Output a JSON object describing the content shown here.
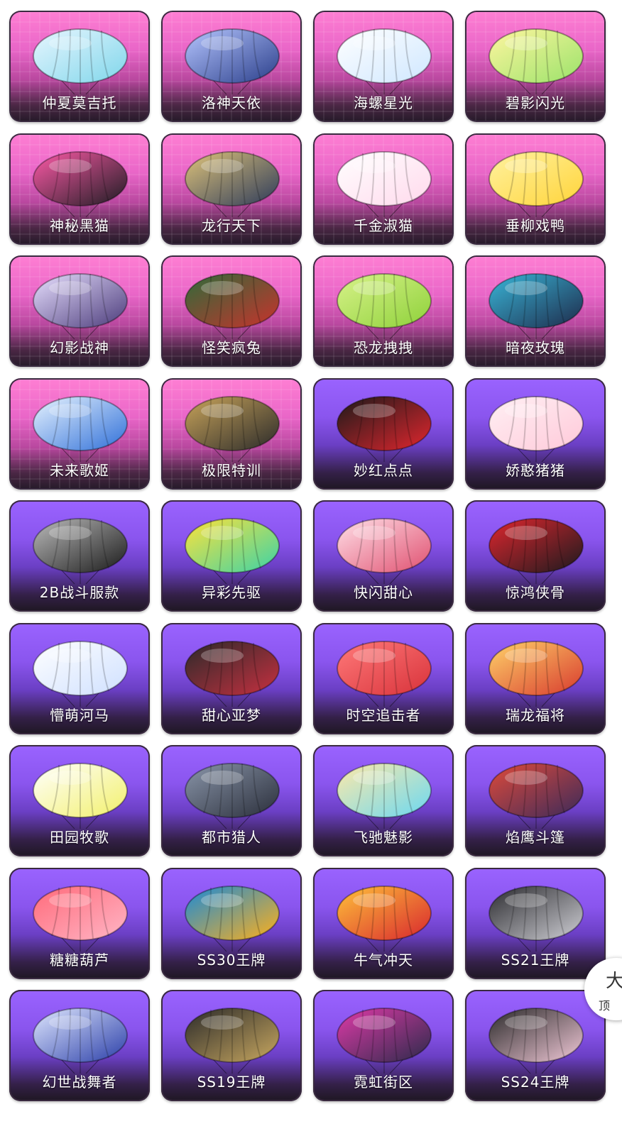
{
  "items": [
    {
      "name": "仲夏莫吉托",
      "theme": "pink",
      "colors": [
        "#7fd6ea",
        "#e8f6ff"
      ],
      "icon": "parachute-icon"
    },
    {
      "name": "洛神天依",
      "theme": "pink",
      "colors": [
        "#2a3e8a",
        "#b6c6ff"
      ],
      "icon": "parachute-icon"
    },
    {
      "name": "海螺星光",
      "theme": "pink",
      "colors": [
        "#cfe7ff",
        "#ffffff"
      ],
      "icon": "parachute-icon"
    },
    {
      "name": "碧影闪光",
      "theme": "pink",
      "colors": [
        "#9ae26a",
        "#fff6a0"
      ],
      "icon": "parachute-icon"
    },
    {
      "name": "神秘黑猫",
      "theme": "pink",
      "colors": [
        "#1c1c22",
        "#ff5aa8"
      ],
      "icon": "parachute-icon"
    },
    {
      "name": "龙行天下",
      "theme": "pink",
      "colors": [
        "#2c3a5a",
        "#e0c47a"
      ],
      "icon": "parachute-icon"
    },
    {
      "name": "千金淑猫",
      "theme": "pink",
      "colors": [
        "#ffd9ec",
        "#ffffff"
      ],
      "icon": "parachute-icon"
    },
    {
      "name": "垂柳戏鸭",
      "theme": "pink",
      "colors": [
        "#ffd43a",
        "#fff2a0"
      ],
      "icon": "parachute-icon"
    },
    {
      "name": "幻影战神",
      "theme": "pink",
      "colors": [
        "#4a3a7a",
        "#e8e0ff"
      ],
      "icon": "parachute-icon"
    },
    {
      "name": "怪笑疯兔",
      "theme": "pink",
      "colors": [
        "#c9322c",
        "#2e6b3a"
      ],
      "icon": "parachute-icon"
    },
    {
      "name": "恐龙拽拽",
      "theme": "pink",
      "colors": [
        "#8ed13a",
        "#d8f28a"
      ],
      "icon": "parachute-icon"
    },
    {
      "name": "暗夜玫瑰",
      "theme": "pink",
      "colors": [
        "#1e2a4a",
        "#39b6d8"
      ],
      "icon": "parachute-icon"
    },
    {
      "name": "未来歌姬",
      "theme": "pink",
      "colors": [
        "#2f6fd8",
        "#e8f4ff"
      ],
      "icon": "parachute-icon"
    },
    {
      "name": "极限特训",
      "theme": "pink",
      "colors": [
        "#2a2a2a",
        "#c9a45a"
      ],
      "icon": "parachute-icon"
    },
    {
      "name": "妙红点点",
      "theme": "purple",
      "colors": [
        "#e2262e",
        "#1a1a1a"
      ],
      "icon": "parachute-icon"
    },
    {
      "name": "娇憨猪猪",
      "theme": "purple",
      "colors": [
        "#ffc9d9",
        "#fff0f4"
      ],
      "icon": "parachute-icon"
    },
    {
      "name": "2B战斗服款",
      "theme": "purple",
      "colors": [
        "#1a1a1a",
        "#bcbcbc"
      ],
      "icon": "parachute-icon"
    },
    {
      "name": "异彩先驱",
      "theme": "purple",
      "colors": [
        "#3ad2a8",
        "#ffe23a"
      ],
      "icon": "parachute-icon"
    },
    {
      "name": "快闪甜心",
      "theme": "purple",
      "colors": [
        "#e05070",
        "#ffe0e8"
      ],
      "icon": "parachute-icon"
    },
    {
      "name": "惊鸿侠骨",
      "theme": "purple",
      "colors": [
        "#1a1a1e",
        "#e0262e"
      ],
      "icon": "parachute-icon"
    },
    {
      "name": "懵萌河马",
      "theme": "purple",
      "colors": [
        "#cfe0ff",
        "#ffffff"
      ],
      "icon": "parachute-icon"
    },
    {
      "name": "甜心亚梦",
      "theme": "purple",
      "colors": [
        "#c83040",
        "#2a2a2a"
      ],
      "icon": "parachute-icon"
    },
    {
      "name": "时空追击者",
      "theme": "purple",
      "colors": [
        "#d8323a",
        "#ff7a7a"
      ],
      "icon": "parachute-icon"
    },
    {
      "name": "瑞龙福将",
      "theme": "purple",
      "colors": [
        "#d83a2e",
        "#ffd36a"
      ],
      "icon": "parachute-icon"
    },
    {
      "name": "田园牧歌",
      "theme": "purple",
      "colors": [
        "#f2f06a",
        "#ffffff"
      ],
      "icon": "parachute-icon"
    },
    {
      "name": "都市猎人",
      "theme": "purple",
      "colors": [
        "#2a2e3a",
        "#8a96aa"
      ],
      "icon": "parachute-icon"
    },
    {
      "name": "飞驰魅影",
      "theme": "purple",
      "colors": [
        "#6ad8f2",
        "#ffe9a8"
      ],
      "icon": "parachute-icon"
    },
    {
      "name": "焰鹰斗篷",
      "theme": "purple",
      "colors": [
        "#3a2a5a",
        "#e04a3a"
      ],
      "icon": "parachute-icon"
    },
    {
      "name": "糖糖葫芦",
      "theme": "purple",
      "colors": [
        "#ffb6c6",
        "#ff6a7a"
      ],
      "icon": "parachute-icon"
    },
    {
      "name": "SS30王牌",
      "theme": "purple",
      "colors": [
        "#ffb01a",
        "#1a8ad8"
      ],
      "icon": "parachute-icon"
    },
    {
      "name": "牛气冲天",
      "theme": "purple",
      "colors": [
        "#d8262e",
        "#ffc23a"
      ],
      "icon": "parachute-icon"
    },
    {
      "name": "SS21王牌",
      "theme": "purple",
      "colors": [
        "#d0d0d6",
        "#2a2a2e"
      ],
      "icon": "parachute-icon"
    },
    {
      "name": "幻世战舞者",
      "theme": "purple",
      "colors": [
        "#2a3ea8",
        "#e0e8ff"
      ],
      "icon": "parachute-icon"
    },
    {
      "name": "SS19王牌",
      "theme": "purple",
      "colors": [
        "#c9a860",
        "#2a2a2a"
      ],
      "icon": "parachute-icon"
    },
    {
      "name": "霓虹街区",
      "theme": "purple",
      "colors": [
        "#2a2a4a",
        "#e03aa8"
      ],
      "icon": "parachute-icon"
    },
    {
      "name": "SS24王牌",
      "theme": "purple",
      "colors": [
        "#f2c9d8",
        "#2a2a2a"
      ],
      "icon": "parachute-icon"
    }
  ],
  "side_widget": {
    "top_glyph": "大",
    "label": "顶"
  }
}
